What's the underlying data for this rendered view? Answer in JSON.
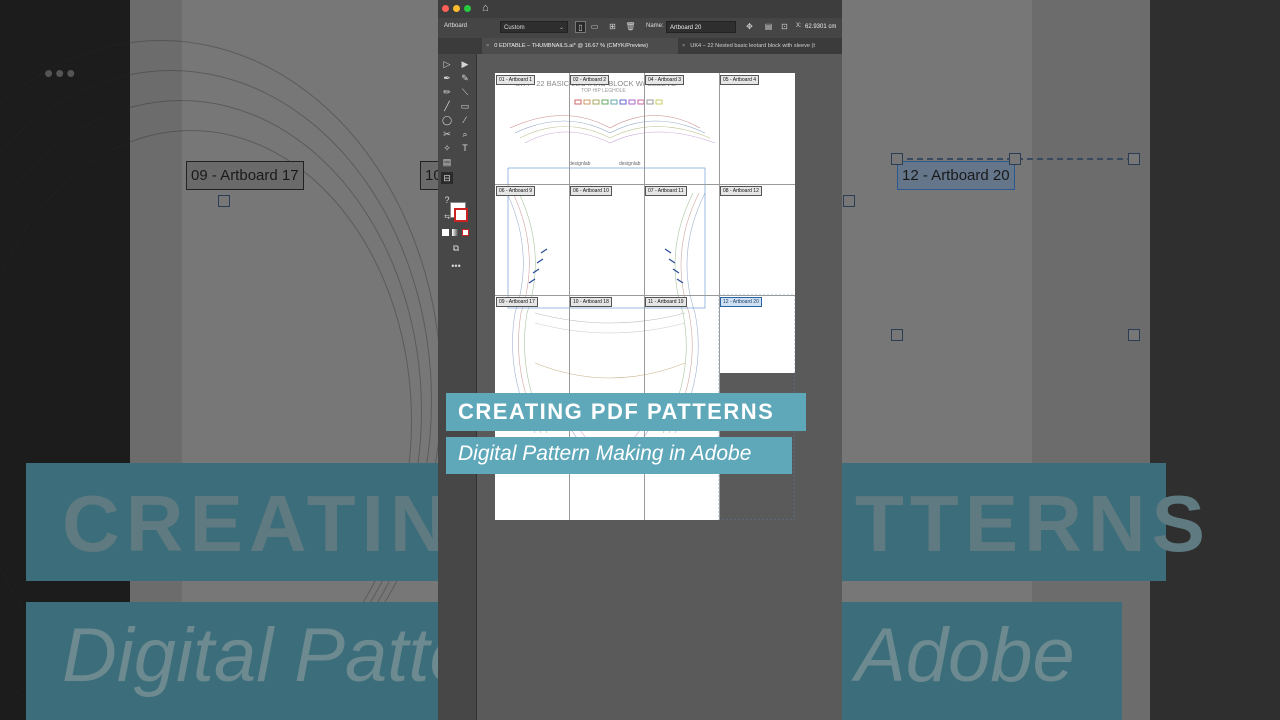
{
  "window": {
    "control_bar": {
      "artboard_label": "Artboard",
      "preset_value": "Custom",
      "name_label": "Name:",
      "name_value": "Artboard 20",
      "x_label": "X:",
      "x_value": "62.9301 cm"
    },
    "tabs": [
      {
        "label": "0 EDITABLE – THUMBNAILS.ai* @ 16.67 % (CMYK/Preview)",
        "active": true
      },
      {
        "label": "UK4 – 22 Nested basic leotard block with sleeve (t",
        "active": false
      }
    ],
    "traffic_lights": {
      "close": "#ff5f57",
      "minimize": "#febc2e",
      "maximize": "#28c840"
    }
  },
  "document": {
    "heading": "UK4 - 22 BASIC LEOTARD BLOCK W/ SLEEVE",
    "subheading": "TOP HIP LEGHOLE",
    "logo_text": "designlab",
    "artboards": [
      {
        "label": "01 - Artboard 1"
      },
      {
        "label": "02 - Artboard 2"
      },
      {
        "label": "04 - Artboard 3"
      },
      {
        "label": "05 - Artboard 4"
      },
      {
        "label": "06 - Artboard 9"
      },
      {
        "label": "06 - Artboard 10"
      },
      {
        "label": "07 - Artboard 11"
      },
      {
        "label": "08 - Artboard 12"
      },
      {
        "label": "09 - Artboard 17"
      },
      {
        "label": "10 - Artboard 18"
      },
      {
        "label": "11 - Artboard 19"
      },
      {
        "label": "12 - Artboard 20",
        "selected": true
      }
    ]
  },
  "background_zoom": {
    "label_left": "09 - Artboard 17",
    "label_mid": "10",
    "label_right": "12 - Artboard 20",
    "big_line1_left": "CREATING",
    "big_line1_right": "TTERNS",
    "big_line2_left": "Digital Patte",
    "big_line2_right": "Adobe"
  },
  "overlay": {
    "title": "CREATING PDF PATTERNS",
    "subtitle": "Digital Pattern Making in Adobe",
    "accent_color": "#5fa8ba"
  },
  "icons": [
    "home-icon",
    "selection-tool-icon",
    "direct-selection-icon",
    "pen-icon",
    "curvature-icon",
    "line-icon",
    "rectangle-icon",
    "ellipse-icon",
    "eyedropper-icon",
    "scissors-icon",
    "zoom-icon",
    "magic-wand-icon",
    "type-icon",
    "artboard-tool-icon",
    "more-tools-icon"
  ]
}
